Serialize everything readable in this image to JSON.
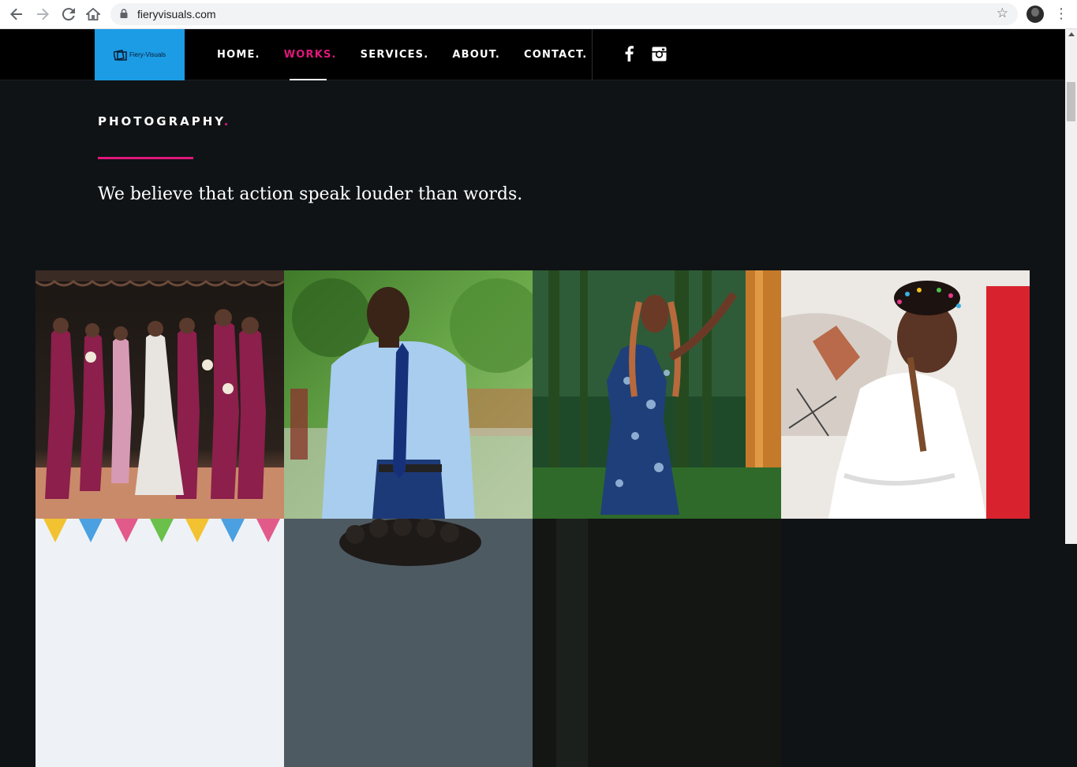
{
  "browser": {
    "url": "fieryvisuals.com"
  },
  "logo": {
    "text": "Fiery-Visuals"
  },
  "nav": {
    "items": [
      {
        "label": "HOME."
      },
      {
        "label": "WORKS."
      },
      {
        "label": "SERVICES."
      },
      {
        "label": "ABOUT."
      },
      {
        "label": "CONTACT."
      }
    ],
    "active_index": 1,
    "social": [
      "facebook-icon",
      "instagram-icon"
    ]
  },
  "section": {
    "title": "PHOTOGRAPHY",
    "title_dot": ".",
    "tagline": "We believe that action speak louder than words."
  },
  "colors": {
    "accent": "#e0177a",
    "logo_bg": "#1b9ce5",
    "header_bg": "#000000",
    "page_bg": "#101316"
  },
  "gallery": {
    "photos": [
      "bridal-party-photo",
      "man-in-blue-shirt-photo",
      "woman-in-floral-dress-photo",
      "baby-in-white-dress-photo",
      "party-bunting-photo",
      "curly-hair-portrait-photo",
      "dark-outdoor-photo"
    ]
  }
}
